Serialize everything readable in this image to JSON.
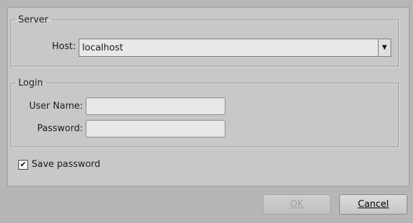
{
  "server": {
    "title": "Server",
    "host_label": "Host:",
    "host_value": "localhost",
    "dropdown_icon": "chevron-down-icon"
  },
  "login": {
    "title": "Login",
    "username_label": "User Name:",
    "username_value": "",
    "password_label": "Password:",
    "password_value": ""
  },
  "save_password": {
    "label": "Save password",
    "checked": true,
    "check_glyph": "✔"
  },
  "buttons": {
    "ok": "OK",
    "cancel": "Cancel"
  }
}
